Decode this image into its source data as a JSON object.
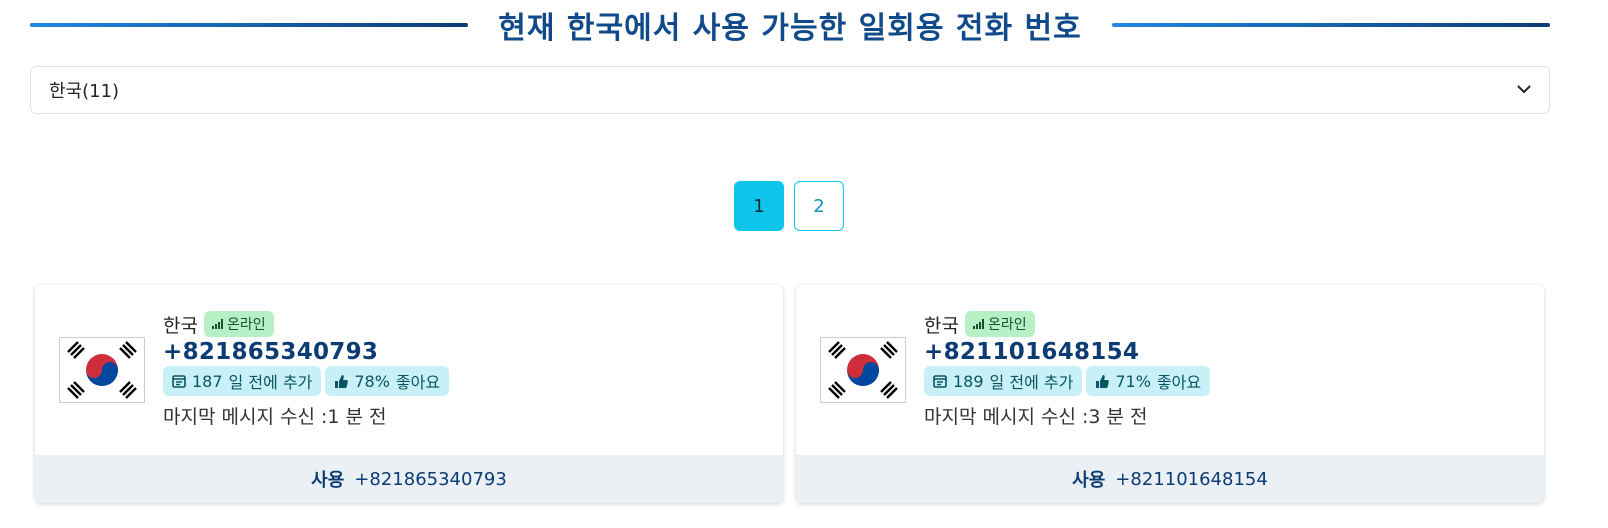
{
  "header": {
    "title": "현재 한국에서 사용 가능한 일회용 전화 번호"
  },
  "country_select": {
    "value": "한국(11)"
  },
  "pagination": {
    "pages": [
      "1",
      "2"
    ],
    "active": "1"
  },
  "cards": [
    {
      "country": "한국",
      "status": "온라인",
      "number": "+821865340793",
      "days_added": "187",
      "days_added_suffix": "일 전에 추가",
      "likes": "78%",
      "likes_suffix": "좋아요",
      "last_message": "마지막 메시지 수신 :1 분 전",
      "use_label": "사용",
      "use_number": "+821865340793"
    },
    {
      "country": "한국",
      "status": "온라인",
      "number": "+821101648154",
      "days_added": "189",
      "days_added_suffix": "일 전에 추가",
      "likes": "71%",
      "likes_suffix": "좋아요",
      "last_message": "마지막 메시지 수신 :3 분 전",
      "use_label": "사용",
      "use_number": "+821101648154"
    }
  ],
  "colors": {
    "title": "#114a8a",
    "accent": "#0dc5ea",
    "online_bg": "#b8f0c6",
    "badge_bg": "#c8f0f7"
  }
}
